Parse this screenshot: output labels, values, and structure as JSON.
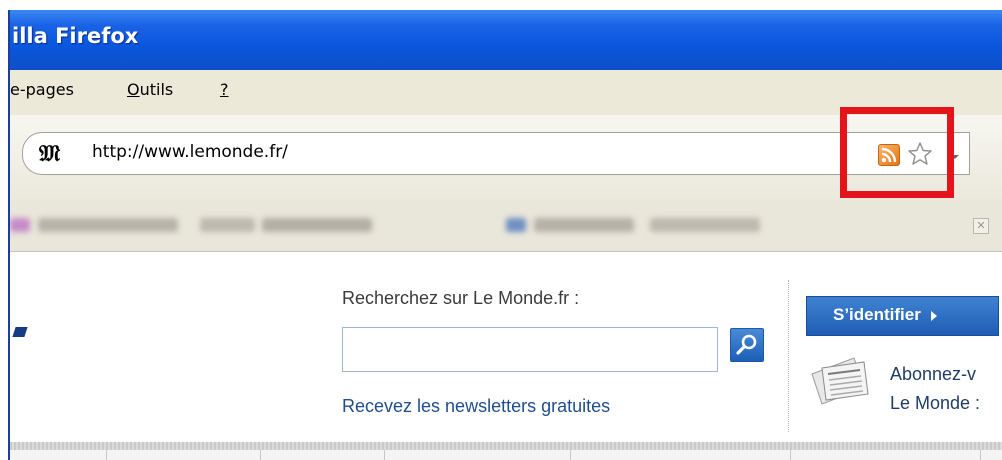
{
  "window": {
    "title": "illa Firefox"
  },
  "menubar": {
    "items": [
      {
        "label": "e-pages"
      },
      {
        "pre": "",
        "accel": "O",
        "post": "utils"
      },
      {
        "pre": "",
        "accel": "?",
        "post": ""
      }
    ]
  },
  "navbar": {
    "url": "http://www.lemonde.fr/",
    "site_icon_glyph": "𝔐",
    "icons": [
      "lemonde-site-icon",
      "rss-feed-icon",
      "bookmark-star-icon",
      "dropdown-arrow-icon"
    ]
  },
  "highlight": {
    "color": "#e5141b"
  },
  "bookmarks": {
    "close_glyph": "✕"
  },
  "content": {
    "search_label": "Recherchez sur Le Monde.fr :",
    "search_value": "",
    "newsletter_link": "Recevez les newsletters gratuites",
    "login_button": "S’identifier",
    "subscribe_line1": "Abonnez-v",
    "subscribe_line2": "Le Monde :"
  },
  "colors": {
    "titlebar": "#0a56dd",
    "accent_blue": "#1f5db5",
    "link": "#1f4e8c",
    "rss_orange": "#e7740f"
  }
}
